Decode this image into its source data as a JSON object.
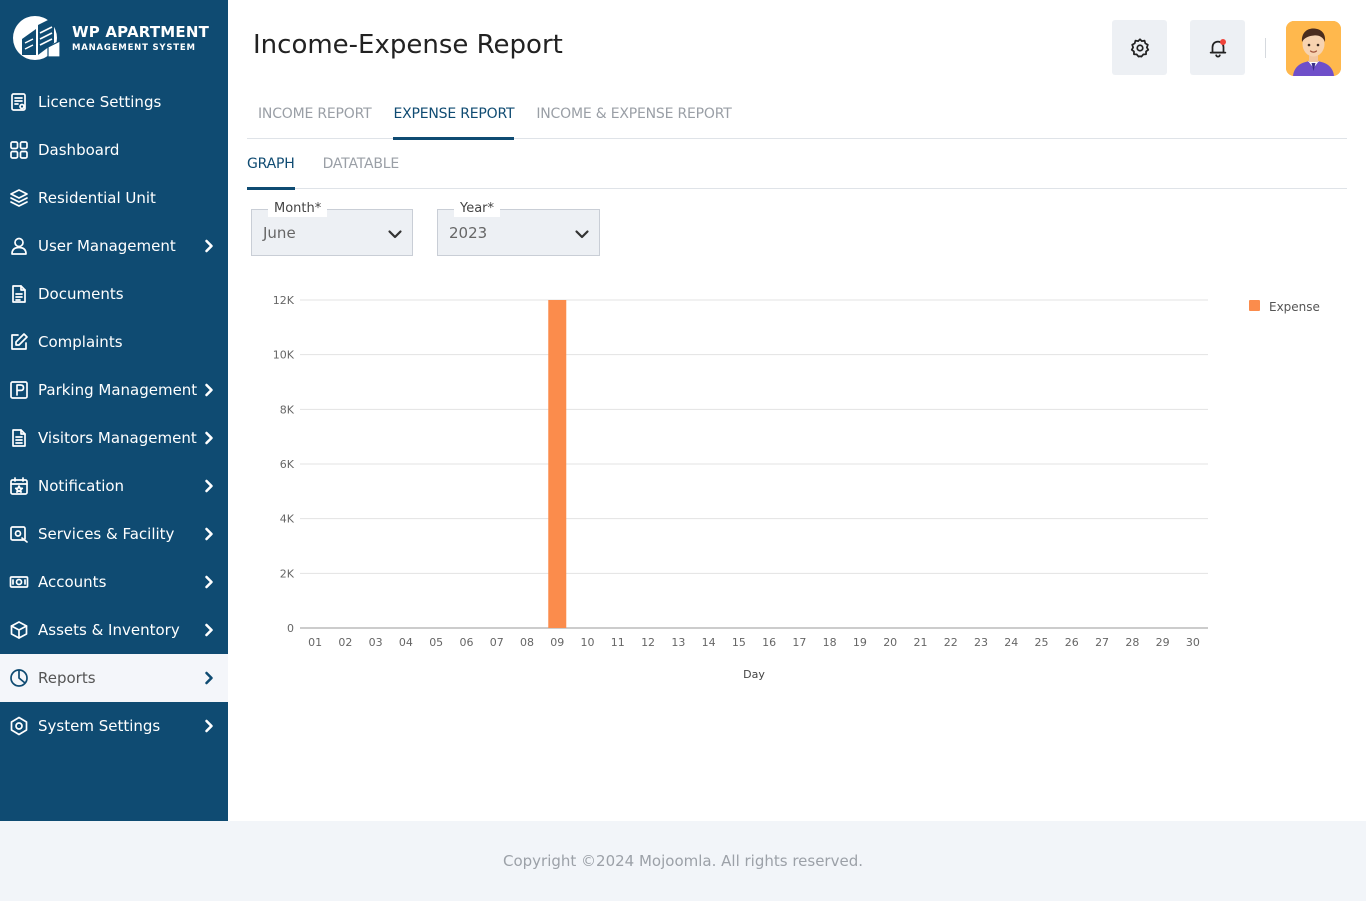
{
  "brand": {
    "title": "WP APARTMENT",
    "subtitle": "MANAGEMENT SYSTEM"
  },
  "sidebar": {
    "items": [
      {
        "label": "Licence Settings",
        "icon": "licence-icon",
        "has_submenu": false
      },
      {
        "label": "Dashboard",
        "icon": "dashboard-grid-icon",
        "has_submenu": false
      },
      {
        "label": "Residential Unit",
        "icon": "layers-icon",
        "has_submenu": false
      },
      {
        "label": "User Management",
        "icon": "user-icon",
        "has_submenu": true
      },
      {
        "label": "Documents",
        "icon": "document-icon",
        "has_submenu": false
      },
      {
        "label": "Complaints",
        "icon": "edit-icon",
        "has_submenu": false
      },
      {
        "label": "Parking Management",
        "icon": "parking-icon",
        "has_submenu": true
      },
      {
        "label": "Visitors Management",
        "icon": "visitors-doc-icon",
        "has_submenu": true
      },
      {
        "label": "Notification",
        "icon": "calendar-star-icon",
        "has_submenu": true
      },
      {
        "label": "Services & Facility",
        "icon": "service-icon",
        "has_submenu": true
      },
      {
        "label": "Accounts",
        "icon": "money-icon",
        "has_submenu": true
      },
      {
        "label": "Assets & Inventory",
        "icon": "box-icon",
        "has_submenu": true
      },
      {
        "label": "Reports",
        "icon": "pie-chart-icon",
        "has_submenu": true,
        "active": true
      },
      {
        "label": "System Settings",
        "icon": "settings-hex-icon",
        "has_submenu": true
      }
    ]
  },
  "header": {
    "title": "Income-Expense Report",
    "settings_icon": "gear-icon",
    "notification_icon": "bell-icon"
  },
  "tabs": {
    "primary": [
      "INCOME REPORT",
      "EXPENSE REPORT",
      "INCOME & EXPENSE REPORT"
    ],
    "primary_active": "EXPENSE REPORT",
    "secondary": [
      "GRAPH",
      "DATATABLE"
    ],
    "secondary_active": "GRAPH"
  },
  "filters": {
    "month_label": "Month*",
    "month_value": "June",
    "year_label": "Year*",
    "year_value": "2023"
  },
  "chart_data": {
    "type": "bar",
    "xlabel": "Day",
    "ylabel": "",
    "ylim": [
      0,
      12000
    ],
    "yticks": [
      "0",
      "2K",
      "4K",
      "6K",
      "8K",
      "10K",
      "12K"
    ],
    "categories": [
      "01",
      "02",
      "03",
      "04",
      "05",
      "06",
      "07",
      "08",
      "09",
      "10",
      "11",
      "12",
      "13",
      "14",
      "15",
      "16",
      "17",
      "18",
      "19",
      "20",
      "21",
      "22",
      "23",
      "24",
      "25",
      "26",
      "27",
      "28",
      "29",
      "30"
    ],
    "series": [
      {
        "name": "Expense",
        "color": "#fb8c4c",
        "values": [
          0,
          0,
          0,
          0,
          0,
          0,
          0,
          0,
          12000,
          0,
          0,
          0,
          0,
          0,
          0,
          0,
          0,
          0,
          0,
          0,
          0,
          0,
          0,
          0,
          0,
          0,
          0,
          0,
          0,
          0
        ]
      }
    ],
    "legend_position": "top-right",
    "grid": true
  },
  "footer": {
    "text": "Copyright ©2024 Mojoomla. All rights reserved."
  }
}
